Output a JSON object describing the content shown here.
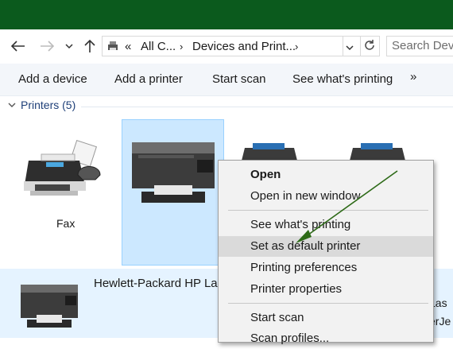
{
  "address": {
    "overflow": "«",
    "crumbs": [
      "All C...",
      "Devices and Print..."
    ]
  },
  "search": {
    "placeholder": "Search Devi"
  },
  "toolbar": {
    "add_device": "Add a device",
    "add_printer": "Add a printer",
    "start_scan": "Start scan",
    "see_printing": "See what's printing",
    "more": "»"
  },
  "group": {
    "label": "Printers (5)"
  },
  "devices": [
    {
      "label": "Fax"
    }
  ],
  "list": {
    "name": "Hewlett-Packard HP La",
    "clipped_1": "Las",
    "clipped_2": "erJe"
  },
  "context_menu": {
    "items": [
      "Open",
      "Open in new window",
      "See what's printing",
      "Set as default printer",
      "Printing preferences",
      "Printer properties",
      "Start scan",
      "Scan profiles..."
    ]
  },
  "colors": {
    "titlebar": "#0b5a1d",
    "selection": "#cce8ff",
    "annotation_arrow": "#2d6a17"
  }
}
